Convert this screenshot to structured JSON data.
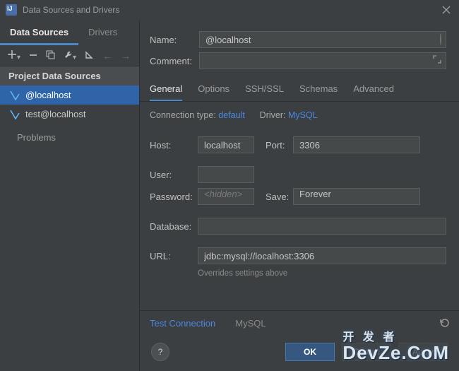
{
  "window": {
    "title": "Data Sources and Drivers"
  },
  "left": {
    "tabs": [
      "Data Sources",
      "Drivers"
    ],
    "section_header": "Project Data Sources",
    "items": [
      {
        "label": "@localhost"
      },
      {
        "label": "test@localhost"
      }
    ],
    "problems": "Problems"
  },
  "form": {
    "name_label": "Name:",
    "name_value": "@localhost",
    "comment_label": "Comment:",
    "comment_value": ""
  },
  "tabs": [
    "General",
    "Options",
    "SSH/SSL",
    "Schemas",
    "Advanced"
  ],
  "conn": {
    "type_label": "Connection type:",
    "type_value": "default",
    "driver_label": "Driver:",
    "driver_value": "MySQL"
  },
  "general": {
    "host_label": "Host:",
    "host_value": "localhost",
    "port_label": "Port:",
    "port_value": "3306",
    "user_label": "User:",
    "user_value": "",
    "password_label": "Password:",
    "password_placeholder": "<hidden>",
    "save_label": "Save:",
    "save_value": "Forever",
    "database_label": "Database:",
    "database_value": "",
    "url_label": "URL:",
    "url_value": "jdbc:mysql://localhost:3306",
    "url_hint": "Overrides settings above"
  },
  "footer": {
    "test_connection": "Test Connection",
    "driver": "MySQL"
  },
  "buttons": {
    "help": "?",
    "ok": "OK",
    "cancel": "Cancel",
    "apply": "Apply"
  },
  "watermark": {
    "line1": "开 发 者",
    "line2": "DevZe.CoM"
  }
}
